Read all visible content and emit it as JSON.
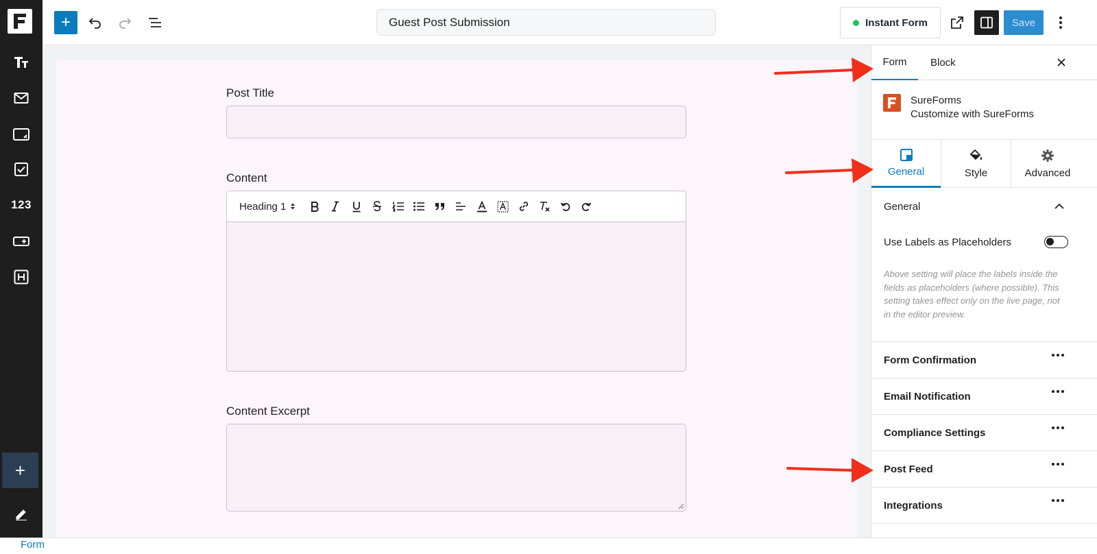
{
  "topbar": {
    "form_title": "Guest Post Submission",
    "instant_form_label": "Instant Form",
    "save_label": "Save"
  },
  "left_bar": {
    "number_block_label": "123"
  },
  "canvas": {
    "fields": [
      {
        "label": "Post Title"
      },
      {
        "label": "Content"
      },
      {
        "label": "Content Excerpt"
      }
    ],
    "editor": {
      "heading_select": "Heading 1"
    }
  },
  "right_panel": {
    "tabs": [
      {
        "label": "Form"
      },
      {
        "label": "Block"
      }
    ],
    "plugin": {
      "name": "SureForms",
      "subtitle": "Customize with SureForms"
    },
    "sub_tabs": [
      {
        "label": "General"
      },
      {
        "label": "Style"
      },
      {
        "label": "Advanced"
      }
    ],
    "general": {
      "title": "General",
      "toggle_label": "Use Labels as Placeholders",
      "toggle_on": false,
      "help_text": "Above setting will place the labels inside the fields as placeholders (where possible). This setting takes effect only on the live page, not in the editor preview."
    },
    "sections": [
      {
        "label": "Form Confirmation"
      },
      {
        "label": "Email Notification"
      },
      {
        "label": "Compliance Settings"
      },
      {
        "label": "Post Feed"
      },
      {
        "label": "Integrations"
      }
    ]
  },
  "bottom_bar": {
    "breadcrumb": "Form"
  },
  "colors": {
    "accent": "#0a7bbd",
    "brand_orange": "#d9501f",
    "annotation_arrow": "#f02e1a",
    "status_green": "#22c55e"
  }
}
